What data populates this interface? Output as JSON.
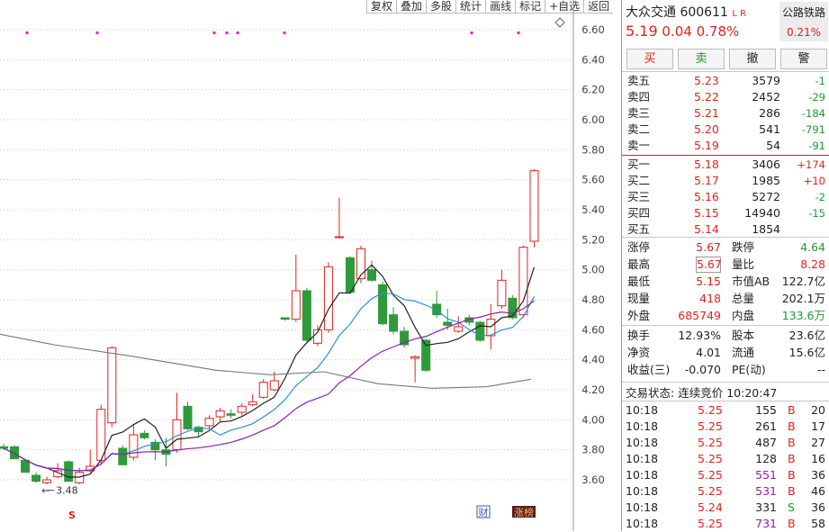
{
  "toolbar": [
    "复权",
    "叠加",
    "多股",
    "统计",
    "画线",
    "标记",
    "+自选",
    "返回"
  ],
  "stock": {
    "name": "大众交通",
    "code": "600611",
    "flags": "L R",
    "price": "5.19",
    "change": "0.04",
    "pct": "0.78%",
    "sector": "公路铁路",
    "sector_pct": "0.21%"
  },
  "actions": [
    "买",
    "卖",
    "撤",
    "警"
  ],
  "asks": [
    {
      "label": "卖五",
      "price": "5.23",
      "vol": "3579",
      "chg": "-1"
    },
    {
      "label": "卖四",
      "price": "5.22",
      "vol": "2452",
      "chg": "-29"
    },
    {
      "label": "卖三",
      "price": "5.21",
      "vol": "286",
      "chg": "-184"
    },
    {
      "label": "卖二",
      "price": "5.20",
      "vol": "541",
      "chg": "-791"
    },
    {
      "label": "卖一",
      "price": "5.19",
      "vol": "54",
      "chg": "-91"
    }
  ],
  "bids": [
    {
      "label": "买一",
      "price": "5.18",
      "vol": "3406",
      "chg": "+174"
    },
    {
      "label": "买二",
      "price": "5.17",
      "vol": "1985",
      "chg": "+10"
    },
    {
      "label": "买三",
      "price": "5.16",
      "vol": "5272",
      "chg": "-2"
    },
    {
      "label": "买四",
      "price": "5.15",
      "vol": "14940",
      "chg": "-15"
    },
    {
      "label": "买五",
      "price": "5.14",
      "vol": "1854",
      "chg": ""
    }
  ],
  "stats": [
    {
      "l1": "涨停",
      "v1": "5.67",
      "c1": "red",
      "l2": "跌停",
      "v2": "4.64",
      "c2": "green"
    },
    {
      "l1": "最高",
      "v1": "5.67",
      "c1": "red",
      "l2": "量比",
      "v2": "8.28",
      "c2": "red"
    },
    {
      "l1": "最低",
      "v1": "5.15",
      "c1": "red",
      "l2": "市值AB",
      "v2": "122.7亿",
      "c2": ""
    },
    {
      "l1": "现量",
      "v1": "418",
      "c1": "red",
      "l2": "总量",
      "v2": "202.1万",
      "c2": ""
    },
    {
      "l1": "外盘",
      "v1": "685749",
      "c1": "red",
      "l2": "内盘",
      "v2": "133.6万",
      "c2": "green"
    }
  ],
  "stats2": [
    {
      "l1": "换手",
      "v1": "12.93%",
      "l2": "股本",
      "v2": "23.6亿"
    },
    {
      "l1": "净资",
      "v1": "4.01",
      "l2": "流通",
      "v2": "15.6亿"
    },
    {
      "l1": "收益(三)",
      "v1": "-0.070",
      "l2": "PE(动)",
      "v2": "--"
    }
  ],
  "trade_status": {
    "label": "交易状态:",
    "value": "连续竞价",
    "time": "10:20:47"
  },
  "ticks": [
    {
      "t": "10:18",
      "p": "5.25",
      "v": "155",
      "s": "B",
      "n": "20",
      "vc": "normal"
    },
    {
      "t": "10:18",
      "p": "5.25",
      "v": "261",
      "s": "B",
      "n": "17",
      "vc": "normal"
    },
    {
      "t": "10:18",
      "p": "5.25",
      "v": "487",
      "s": "B",
      "n": "27",
      "vc": "normal"
    },
    {
      "t": "10:18",
      "p": "5.25",
      "v": "128",
      "s": "B",
      "n": "16",
      "vc": "normal"
    },
    {
      "t": "10:18",
      "p": "5.25",
      "v": "551",
      "s": "B",
      "n": "36",
      "vc": "big"
    },
    {
      "t": "10:18",
      "p": "5.25",
      "v": "531",
      "s": "B",
      "n": "46",
      "vc": "big"
    },
    {
      "t": "10:18",
      "p": "5.24",
      "v": "331",
      "s": "S",
      "n": "36",
      "vc": "normal"
    },
    {
      "t": "10:18",
      "p": "5.25",
      "v": "731",
      "s": "B",
      "n": "58",
      "vc": "big"
    }
  ],
  "colors": {
    "up": "#e0231c",
    "down": "#2e9a3a",
    "ma5": "#222222",
    "ma10": "#2f8fd6",
    "ma20": "#8b1fb3",
    "ma60": "#777777",
    "marker": "#e020e0"
  },
  "chart_data": {
    "type": "candlestick",
    "y_ticks": [
      "6.60",
      "6.40",
      "6.20",
      "6.00",
      "5.80",
      "5.60",
      "5.40",
      "5.20",
      "5.00",
      "4.80",
      "4.60",
      "4.40",
      "4.20",
      "4.00",
      "3.80",
      "3.60"
    ],
    "ylim": [
      3.5,
      6.7
    ],
    "low_label": "3.48",
    "badges": [
      "财",
      "涨榜"
    ],
    "candles": [
      [
        3.82,
        3.81,
        3.84,
        3.8
      ],
      [
        3.82,
        3.74,
        3.83,
        3.74
      ],
      [
        3.73,
        3.65,
        3.74,
        3.65
      ],
      [
        3.63,
        3.59,
        3.65,
        3.58
      ],
      [
        3.58,
        3.6,
        3.62,
        3.57
      ],
      [
        3.62,
        3.66,
        3.71,
        3.61
      ],
      [
        3.72,
        3.59,
        3.73,
        3.59
      ],
      [
        3.58,
        3.65,
        3.68,
        3.57
      ],
      [
        3.66,
        3.69,
        3.8,
        3.65
      ],
      [
        3.73,
        4.07,
        4.1,
        3.7
      ],
      [
        3.98,
        4.48,
        4.49,
        3.95
      ],
      [
        3.81,
        3.7,
        3.83,
        3.7
      ],
      [
        3.75,
        3.9,
        3.97,
        3.73
      ],
      [
        3.91,
        3.88,
        3.93,
        3.87
      ],
      [
        3.85,
        3.8,
        3.87,
        3.73
      ],
      [
        3.8,
        3.77,
        3.88,
        3.69
      ],
      [
        3.8,
        4.0,
        4.18,
        3.78
      ],
      [
        4.09,
        3.94,
        4.12,
        3.93
      ],
      [
        3.95,
        3.92,
        3.96,
        3.89
      ],
      [
        3.96,
        4.01,
        4.03,
        3.94
      ],
      [
        4.02,
        4.06,
        4.08,
        3.99
      ],
      [
        4.04,
        4.03,
        4.07,
        4.01
      ],
      [
        4.05,
        4.09,
        4.11,
        4.03
      ],
      [
        4.1,
        4.12,
        4.17,
        4.09
      ],
      [
        4.15,
        4.25,
        4.27,
        4.14
      ],
      [
        4.2,
        4.26,
        4.32,
        4.19
      ],
      [
        4.68,
        4.67,
        4.68,
        4.66
      ],
      [
        4.67,
        4.86,
        5.1,
        4.65
      ],
      [
        4.86,
        4.53,
        4.88,
        4.52
      ],
      [
        4.51,
        4.6,
        4.63,
        4.49
      ],
      [
        4.6,
        5.02,
        5.05,
        4.58
      ],
      [
        5.22,
        5.22,
        5.48,
        5.21
      ],
      [
        5.08,
        4.85,
        5.09,
        4.84
      ],
      [
        4.94,
        5.14,
        5.16,
        4.91
      ],
      [
        5.0,
        4.93,
        5.06,
        4.92
      ],
      [
        4.9,
        4.64,
        4.92,
        4.63
      ],
      [
        4.7,
        4.59,
        4.75,
        4.57
      ],
      [
        4.59,
        4.5,
        4.62,
        4.48
      ],
      [
        4.41,
        4.42,
        4.43,
        4.25
      ],
      [
        4.53,
        4.33,
        4.54,
        4.32
      ],
      [
        4.77,
        4.7,
        4.86,
        4.68
      ],
      [
        4.65,
        4.63,
        4.74,
        4.6
      ],
      [
        4.59,
        4.62,
        4.69,
        4.58
      ],
      [
        4.68,
        4.65,
        4.7,
        4.63
      ],
      [
        4.65,
        4.53,
        4.66,
        4.52
      ],
      [
        4.56,
        4.67,
        4.77,
        4.47
      ],
      [
        4.76,
        4.93,
        5.0,
        4.74
      ],
      [
        4.81,
        4.68,
        4.83,
        4.67
      ],
      [
        4.7,
        5.15,
        5.16,
        4.68
      ],
      [
        5.19,
        5.66,
        5.67,
        5.15
      ]
    ],
    "markers_top": [
      5,
      15,
      33,
      36,
      38,
      45,
      72,
      83
    ]
  }
}
